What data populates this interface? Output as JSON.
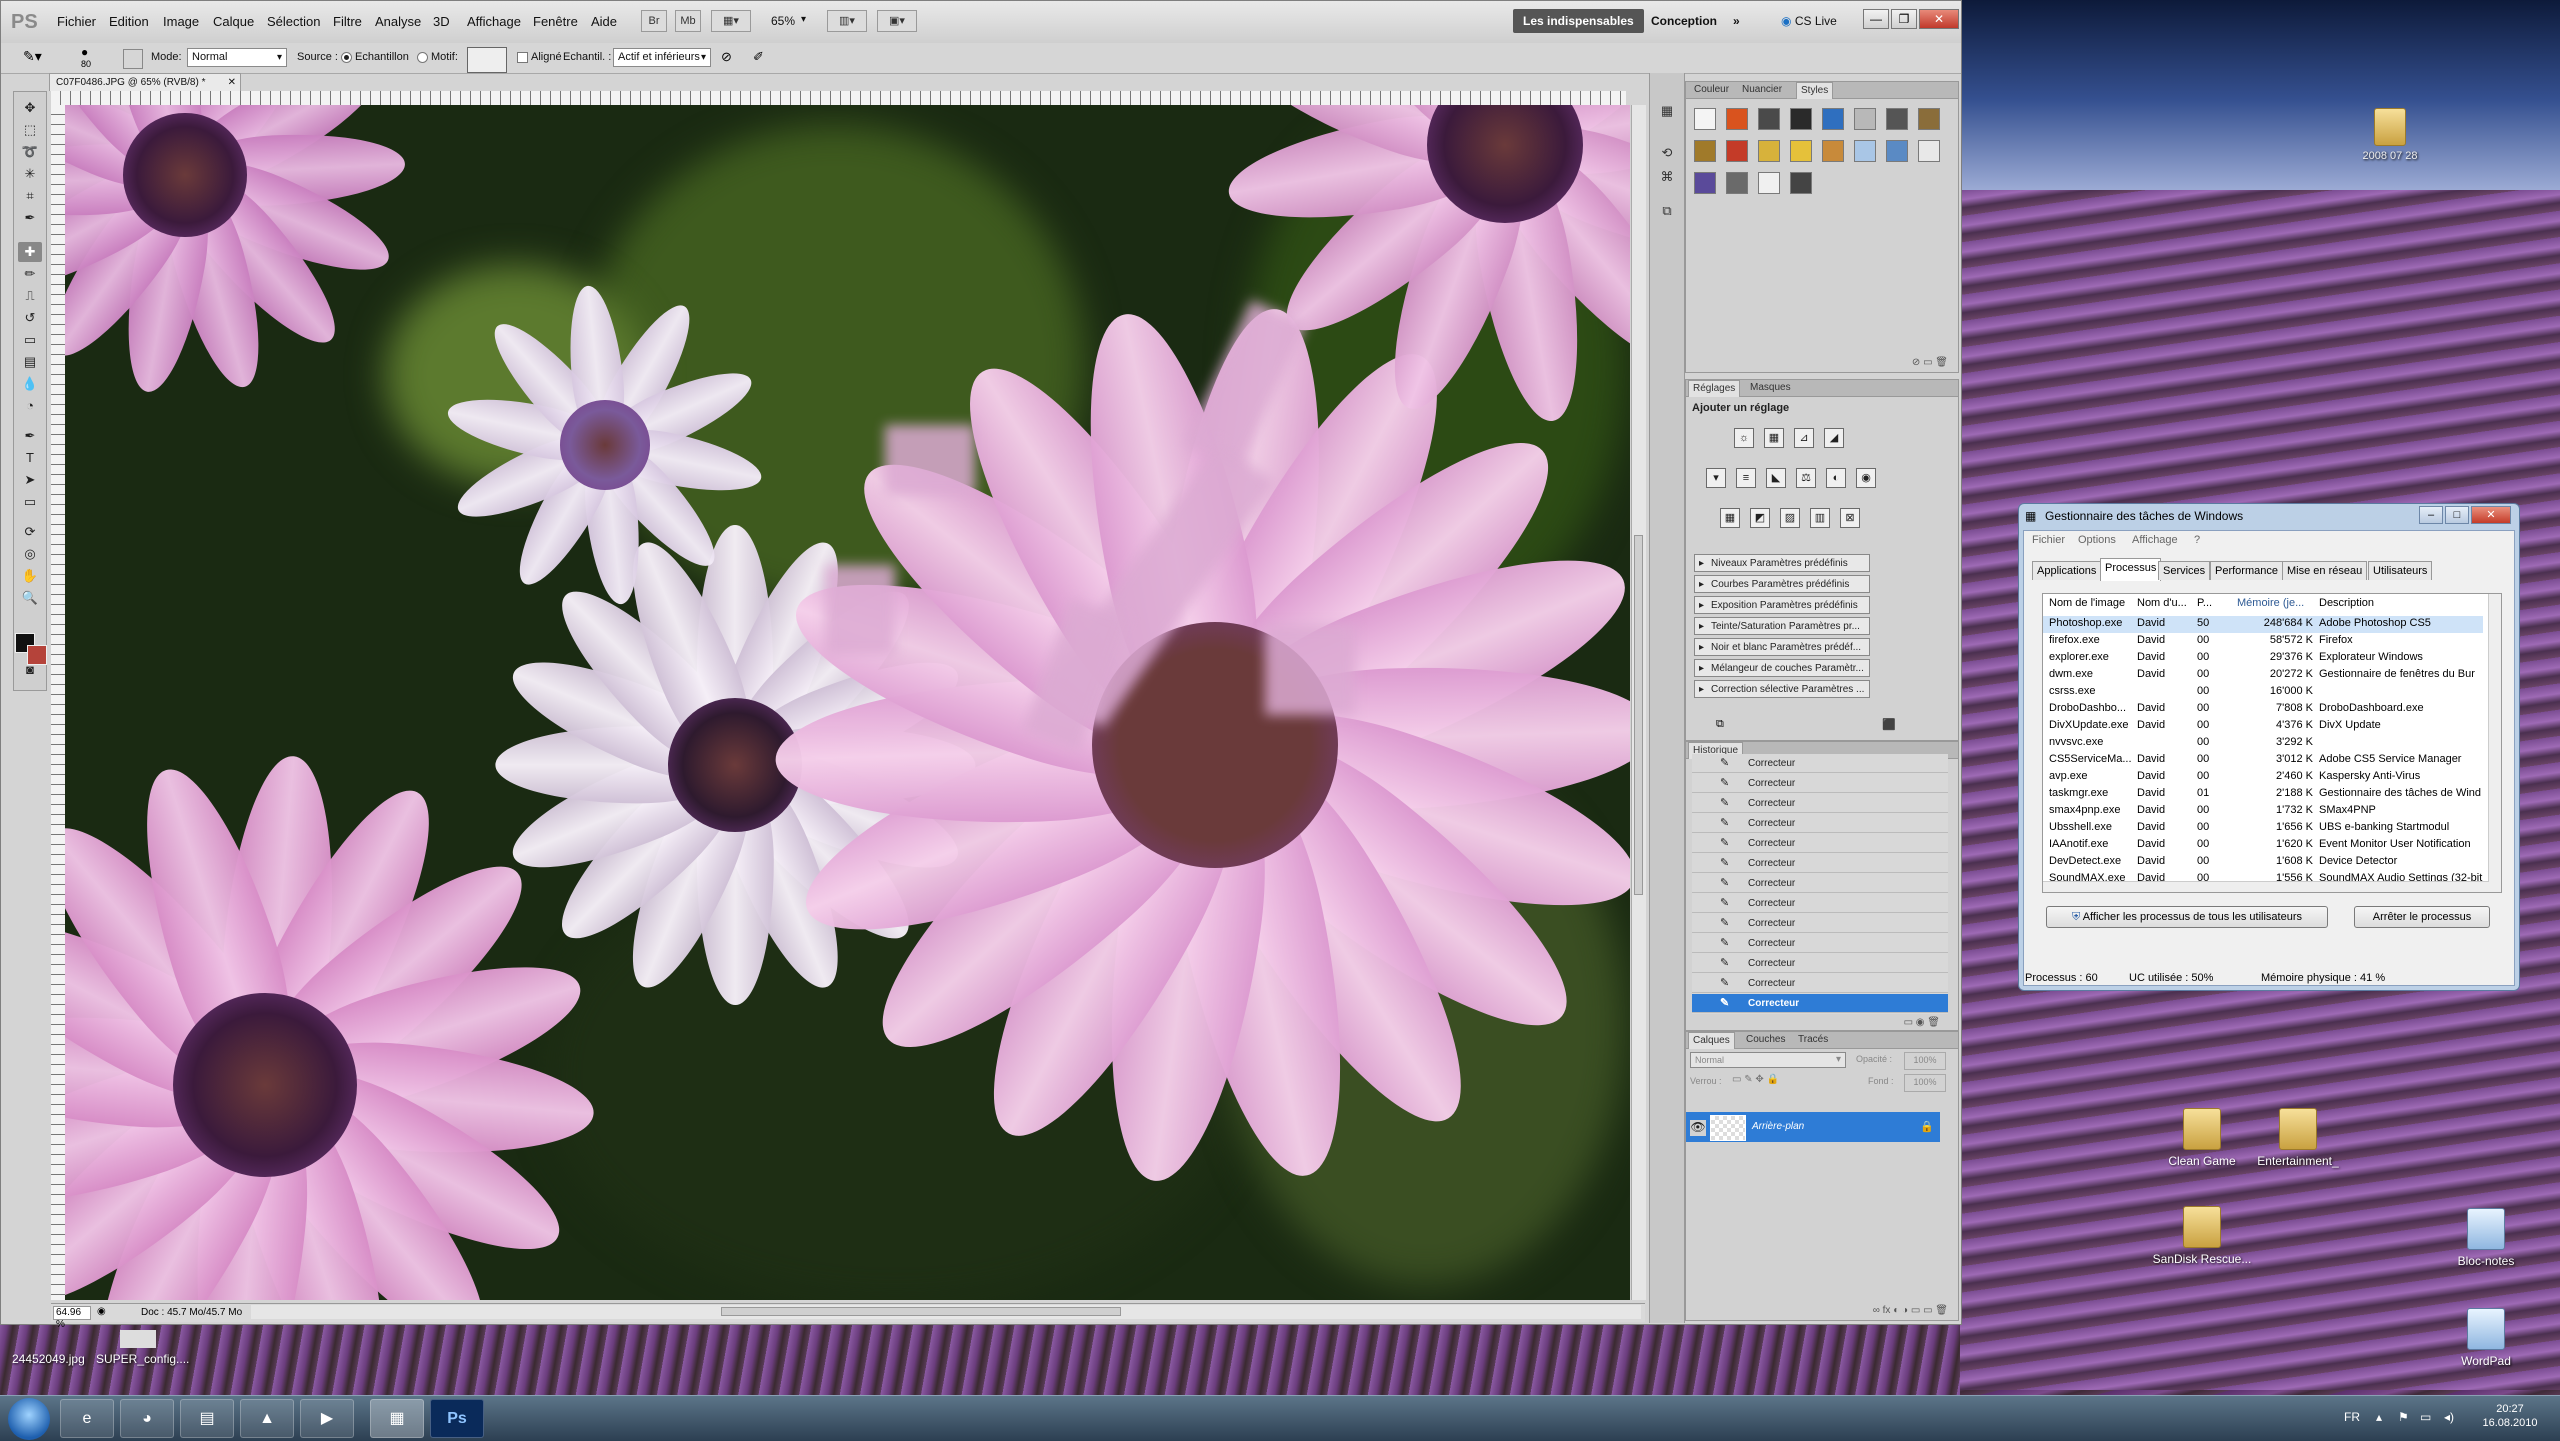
{
  "colors": {
    "ps_chrome": "#d4d4d4",
    "selection": "#2e7cd6",
    "petal": "#e5a9d6",
    "petal_light": "#f3d3ec",
    "disk": "#3b1a3b",
    "foliage": "#1a2a12"
  },
  "ps": {
    "logo": "PS",
    "menu": [
      "Fichier",
      "Edition",
      "Image",
      "Calque",
      "Sélection",
      "Filtre",
      "Analyse",
      "3D",
      "Affichage",
      "Fenêtre",
      "Aide"
    ],
    "zoom_value": "65%",
    "workspaces": {
      "active": "Les indispensables",
      "other": "Conception",
      "more": "»",
      "cs_live": "CS Live"
    },
    "options": {
      "brush_size": "80",
      "mode_label": "Mode:",
      "mode_value": "Normal",
      "source_label": "Source :",
      "source_sample": "Echantillon",
      "source_pattern": "Motif:",
      "aligned": "Aligné",
      "sample_label": "Echantil. :",
      "sample_value": "Actif et inférieurs"
    },
    "doc_tab": "C07F0486.JPG @ 65% (RVB/8) *",
    "status": {
      "zoom": "64.96 %",
      "doc": "Doc : 45.7 Mo/45.7 Mo"
    }
  },
  "swatch_panel": {
    "tabs": [
      "Couleur",
      "Nuancier",
      "Styles"
    ],
    "active": "Styles"
  },
  "adjust_panel": {
    "tabs": [
      "Réglages",
      "Masques"
    ],
    "heading": "Ajouter un réglage",
    "presets": [
      "Niveaux Paramètres prédéfinis",
      "Courbes Paramètres prédéfinis",
      "Exposition Paramètres prédéfinis",
      "Teinte/Saturation Paramètres pr...",
      "Noir et blanc Paramètres prédéf...",
      "Mélangeur de couches Paramètr...",
      "Correction sélective Paramètres ..."
    ]
  },
  "history_panel": {
    "tab": "Historique",
    "items": [
      "Correcteur",
      "Correcteur",
      "Correcteur",
      "Correcteur",
      "Correcteur",
      "Correcteur",
      "Correcteur",
      "Correcteur",
      "Correcteur",
      "Correcteur",
      "Correcteur",
      "Correcteur",
      "Correcteur"
    ]
  },
  "layers_panel": {
    "tabs": [
      "Calques",
      "Couches",
      "Tracés"
    ],
    "blend": "Normal",
    "opacity_label": "Opacité :",
    "opacity": "100%",
    "lock_label": "Verrou :",
    "fill_label": "Fond :",
    "fill": "100%",
    "layer_name": "Arrière-plan"
  },
  "taskmgr": {
    "title": "Gestionnaire des tâches de Windows",
    "menu": [
      "Fichier",
      "Options",
      "Affichage",
      "?"
    ],
    "tabs": [
      "Applications",
      "Processus",
      "Services",
      "Performance",
      "Mise en réseau",
      "Utilisateurs"
    ],
    "active_tab": "Processus",
    "headers": [
      "Nom de l'image",
      "Nom d'u...",
      "P...",
      "Mémoire (je...",
      "Description"
    ],
    "rows": [
      [
        "Photoshop.exe",
        "David",
        "50",
        "248'684 K",
        "Adobe Photoshop CS5"
      ],
      [
        "firefox.exe",
        "David",
        "00",
        "58'572 K",
        "Firefox"
      ],
      [
        "explorer.exe",
        "David",
        "00",
        "29'376 K",
        "Explorateur Windows"
      ],
      [
        "dwm.exe",
        "David",
        "00",
        "20'272 K",
        "Gestionnaire de fenêtres du Bur"
      ],
      [
        "csrss.exe",
        "",
        "00",
        "16'000 K",
        ""
      ],
      [
        "DroboDashbo...",
        "David",
        "00",
        "7'808 K",
        "DroboDashboard.exe"
      ],
      [
        "DivXUpdate.exe",
        "David",
        "00",
        "4'376 K",
        "DivX Update"
      ],
      [
        "nvvsvc.exe",
        "",
        "00",
        "3'292 K",
        ""
      ],
      [
        "CS5ServiceMa...",
        "David",
        "00",
        "3'012 K",
        "Adobe CS5 Service Manager"
      ],
      [
        "avp.exe",
        "David",
        "00",
        "2'460 K",
        "Kaspersky Anti-Virus"
      ],
      [
        "taskmgr.exe",
        "David",
        "01",
        "2'188 K",
        "Gestionnaire des tâches de Wind"
      ],
      [
        "smax4pnp.exe",
        "David",
        "00",
        "1'732 K",
        "SMax4PNP"
      ],
      [
        "Ubsshell.exe",
        "David",
        "00",
        "1'656 K",
        "UBS e-banking Startmodul"
      ],
      [
        "IAAnotif.exe",
        "David",
        "00",
        "1'620 K",
        "Event Monitor User Notification"
      ],
      [
        "DevDetect.exe",
        "David",
        "00",
        "1'608 K",
        "Device Detector"
      ],
      [
        "SoundMAX.exe",
        "David",
        "00",
        "1'556 K",
        "SoundMAX Audio Settings (32-bit"
      ]
    ],
    "btn_show_all": "Afficher les processus de tous les utilisateurs",
    "btn_end": "Arrêter le processus",
    "status": {
      "processes": "Processus : 60",
      "cpu": "UC utilisée : 50%",
      "memory": "Mémoire physique : 41 %"
    }
  },
  "desktop": {
    "icons": [
      "Clean Game",
      "Entertainment_",
      "SanDisk Rescue...",
      "Bloc-notes",
      "WordPad"
    ],
    "thumbs": [
      "24452049.jpg",
      "SUPER_config...."
    ]
  },
  "taskbar": {
    "lang": "FR",
    "time": "20:27",
    "date": "16.08.2010"
  }
}
